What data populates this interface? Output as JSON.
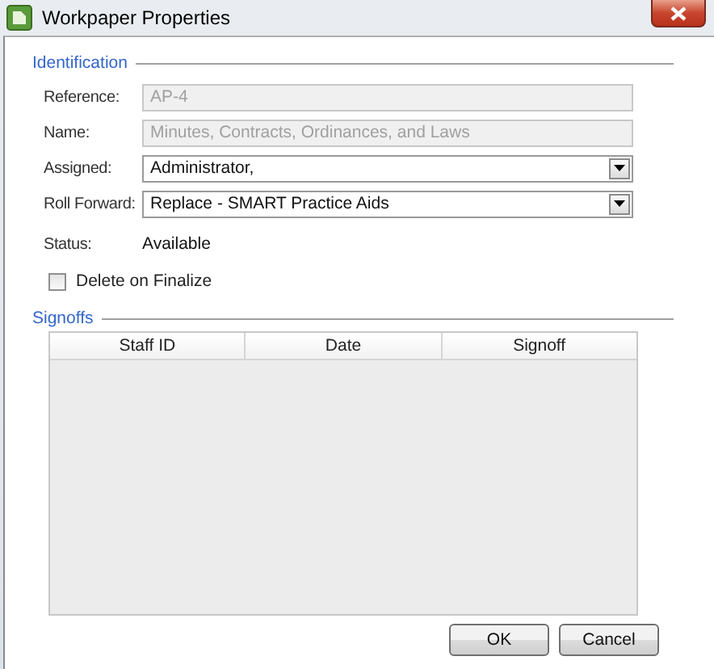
{
  "window": {
    "title": "Workpaper Properties"
  },
  "identification": {
    "heading": "Identification",
    "fields": [
      {
        "kind": "text",
        "label": "Reference:",
        "value": "AP-4",
        "disabled": true
      },
      {
        "kind": "text",
        "label": "Name:",
        "value": "Minutes, Contracts, Ordinances, and Laws",
        "disabled": true
      },
      {
        "kind": "dropdown",
        "label": "Assigned:",
        "value": "Administrator,",
        "disabled": false
      },
      {
        "kind": "dropdown",
        "label": "Roll Forward:",
        "value": "Replace - SMART Practice Aids",
        "disabled": false
      },
      {
        "kind": "static",
        "label": "Status:",
        "value": "Available"
      }
    ],
    "delete_on_finalize": {
      "label": "Delete on Finalize",
      "checked": false
    }
  },
  "signoffs": {
    "heading": "Signoffs",
    "columns": [
      "Staff ID",
      "Date",
      "Signoff"
    ]
  },
  "buttons": [
    "OK",
    "Cancel"
  ]
}
